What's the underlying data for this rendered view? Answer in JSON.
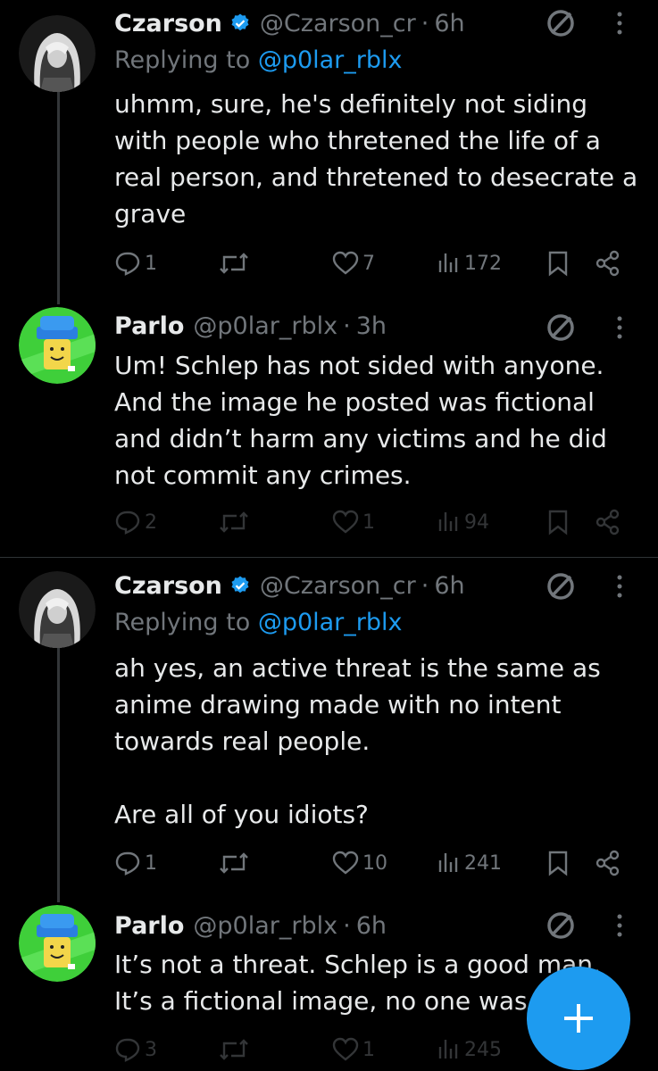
{
  "tweets": [
    {
      "name": "Czarson",
      "handle": "@Czarson_cr",
      "time": "6h",
      "replying_prefix": "Replying to ",
      "replying_to": "@p0lar_rblx",
      "text": "uhmm, sure, he's definitely not siding with people who thretened the life of a real person, and thretened to desecrate a grave",
      "replies": "1",
      "likes": "7",
      "views": "172"
    },
    {
      "name": "Parlo",
      "handle": "@p0lar_rblx",
      "time": "3h",
      "text": "Um! Schlep has not sided with anyone. And the image he posted was fictional and didn’t harm any victims and he did not commit any crimes.",
      "replies": "2",
      "likes": "1",
      "views": "94"
    },
    {
      "name": "Czarson",
      "handle": "@Czarson_cr",
      "time": "6h",
      "replying_prefix": "Replying to ",
      "replying_to": "@p0lar_rblx",
      "text": "ah yes, an active threat is the same as anime drawing made with no intent towards real people.\n\nAre all of you idiots?",
      "replies": "1",
      "likes": "10",
      "views": "241"
    },
    {
      "name": "Parlo",
      "handle": "@p0lar_rblx",
      "time": "6h",
      "text": "It’s not a threat. Schlep is a good man. It’s a fictional image, no one was harm",
      "replies": "3",
      "likes": "1",
      "views": "245"
    }
  ],
  "icons": {
    "verified": "verified-badge-icon",
    "no_entry": "no-entry-icon",
    "more": "more-vertical-icon",
    "reply": "reply-icon",
    "retweet": "retweet-icon",
    "like": "heart-icon",
    "views": "views-icon",
    "bookmark": "bookmark-icon",
    "share": "share-icon",
    "compose": "plus-icon"
  },
  "colors": {
    "background": "#000000",
    "text": "#e7e9ea",
    "muted": "#71767b",
    "accent": "#1d9bf0",
    "thread_line": "#333639"
  }
}
